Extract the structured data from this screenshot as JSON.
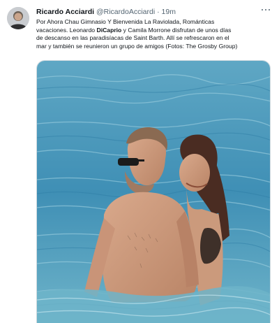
{
  "tweet": {
    "author_name": "Ricardo Acciardi",
    "handle": "@RicardoAcciardi",
    "separator": "·",
    "time": "19m",
    "text_lines": [
      {
        "a": "Por Ahora Chau Gimnasio Y Bienvenida La Raviolada, Románticas",
        "b": "",
        "c": ""
      },
      {
        "a": "vacaciones. Leonardo ",
        "b": "DiCaprio",
        "c": " y Camila Morrone disfrutan de unos días"
      },
      {
        "a": "de descanso en las paradisíacas de Saint Barth. Allí se refrescaron en el",
        "b": "",
        "c": ""
      },
      {
        "a": "mar y también se reunieron un grupo de amigos (Fotos: The Grosby Group)",
        "b": "",
        "c": ""
      }
    ]
  },
  "icons": {
    "avatar": "profile-avatar",
    "more": "more-options-icon"
  },
  "colors": {
    "text": "#0f1419",
    "secondary": "#536471",
    "sea": "#4d9bbd"
  }
}
